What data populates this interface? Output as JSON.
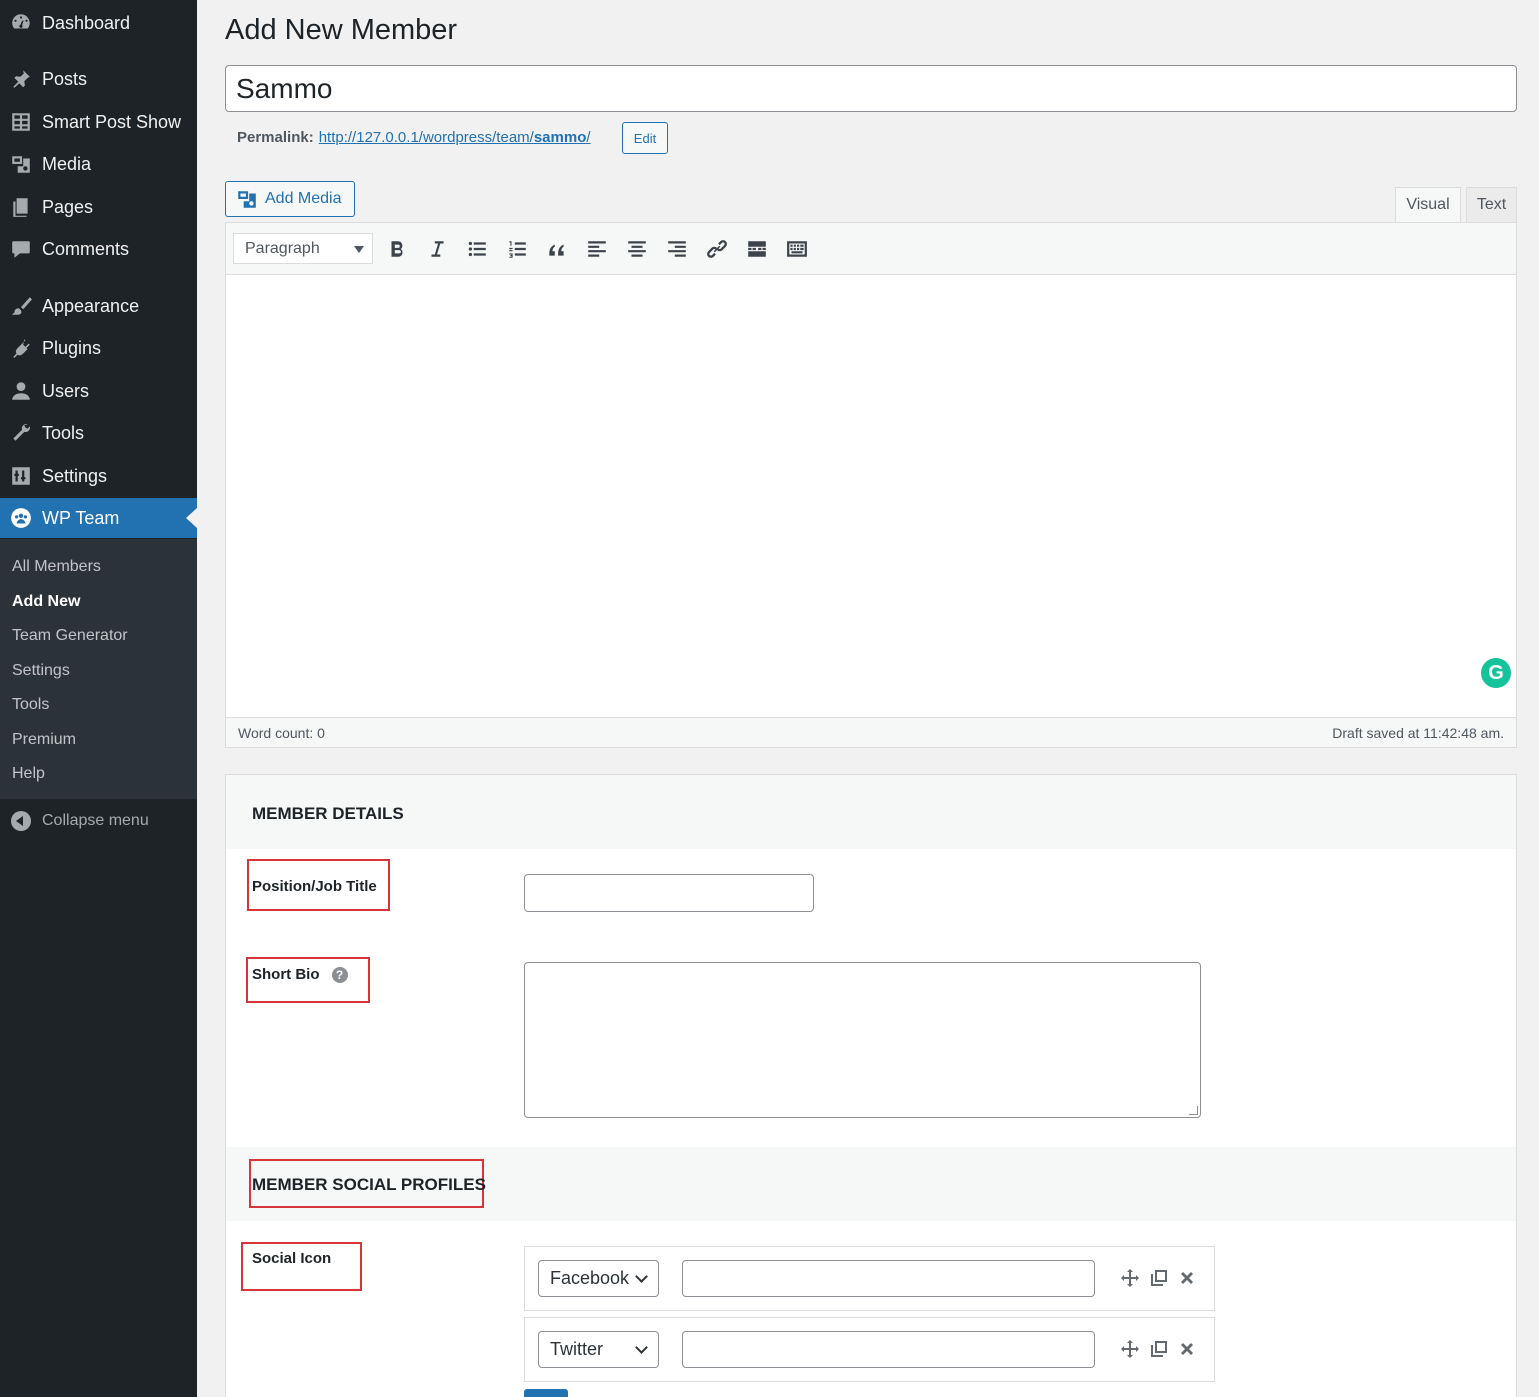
{
  "sidebar": {
    "items": [
      {
        "label": "Dashboard",
        "icon": "dashboard-icon"
      },
      {
        "label": "Posts",
        "icon": "pin-icon"
      },
      {
        "label": "Smart Post Show",
        "icon": "grid-icon"
      },
      {
        "label": "Media",
        "icon": "media-icon"
      },
      {
        "label": "Pages",
        "icon": "pages-icon"
      },
      {
        "label": "Comments",
        "icon": "comment-icon"
      },
      {
        "label": "Appearance",
        "icon": "brush-icon"
      },
      {
        "label": "Plugins",
        "icon": "plug-icon"
      },
      {
        "label": "Users",
        "icon": "user-icon"
      },
      {
        "label": "Tools",
        "icon": "wrench-icon"
      },
      {
        "label": "Settings",
        "icon": "sliders-icon"
      },
      {
        "label": "WP Team",
        "icon": "team-icon"
      }
    ],
    "submenu": [
      "All Members",
      "Add New",
      "Team Generator",
      "Settings",
      "Tools",
      "Premium",
      "Help"
    ],
    "collapse_label": "Collapse menu"
  },
  "page": {
    "title": "Add New Member",
    "post_title": "Sammo",
    "permalink_label": "Permalink:",
    "permalink_base": "http://127.0.0.1/wordpress/team/",
    "permalink_slug": "sammo",
    "permalink_trail": "/",
    "edit_label": "Edit"
  },
  "editor": {
    "add_media_label": "Add Media",
    "tabs": [
      "Visual",
      "Text"
    ],
    "format": "Paragraph",
    "word_count": "Word count: 0",
    "draft_status": "Draft saved at 11:42:48 am.",
    "grammarly": "G"
  },
  "member_details": {
    "title": "MEMBER DETAILS",
    "position_label": "Position/Job Title",
    "position_value": "",
    "short_bio_label": "Short Bio",
    "help_glyph": "?",
    "short_bio_value": ""
  },
  "social": {
    "title": "MEMBER SOCIAL PROFILES",
    "icon_label": "Social Icon",
    "rows": [
      {
        "network": "Facebook",
        "url": ""
      },
      {
        "network": "Twitter",
        "url": ""
      }
    ]
  },
  "colors": {
    "sidebar_bg": "#1d2327",
    "accent": "#2271b1",
    "highlight_box": "#d63638"
  }
}
